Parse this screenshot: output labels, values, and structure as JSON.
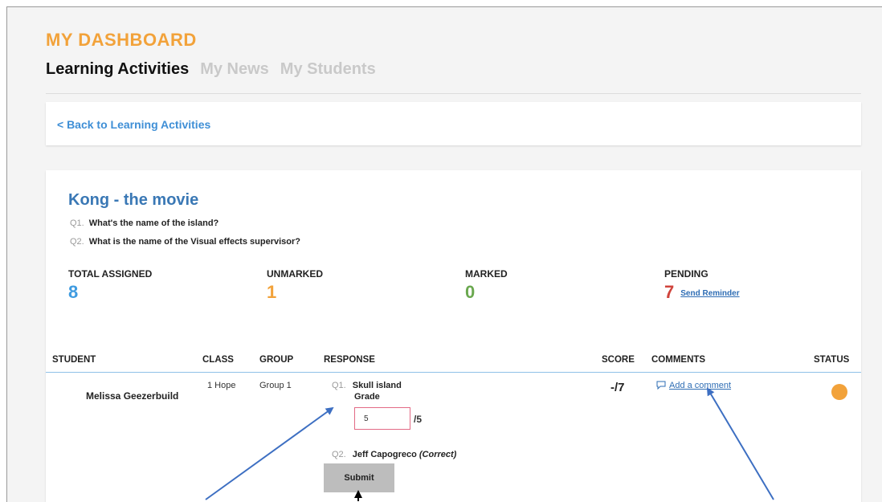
{
  "header": {
    "title": "MY DASHBOARD",
    "tabs": [
      {
        "label": "Learning Activities",
        "active": true
      },
      {
        "label": "My News",
        "active": false
      },
      {
        "label": "My Students",
        "active": false
      }
    ]
  },
  "back_link": "< Back to Learning Activities",
  "activity": {
    "title": "Kong - the movie",
    "questions": [
      {
        "num": "Q1.",
        "text": "What's the name of the island?"
      },
      {
        "num": "Q2.",
        "text": "What is the name of the Visual effects supervisor?"
      }
    ]
  },
  "stats": {
    "total_assigned": {
      "label": "TOTAL ASSIGNED",
      "value": "8",
      "color": "#3f9be0"
    },
    "unmarked": {
      "label": "UNMARKED",
      "value": "1",
      "color": "#f2a23a"
    },
    "marked": {
      "label": "MARKED",
      "value": "0",
      "color": "#6aa84f"
    },
    "pending": {
      "label": "PENDING",
      "value": "7",
      "color": "#d0443c"
    },
    "send_reminder": "Send Reminder"
  },
  "table": {
    "headers": {
      "student": "STUDENT",
      "class": "CLASS",
      "group": "GROUP",
      "response": "RESPONSE",
      "score": "SCORE",
      "comments": "COMMENTS",
      "status": "STATUS"
    },
    "row": {
      "student": "Melissa Geezerbuild",
      "class": "1 Hope",
      "group": "Group 1",
      "q1_num": "Q1.",
      "q1_answer": "Skull island",
      "grade_label": "Grade",
      "grade_value": "5",
      "grade_max": "/5",
      "q2_num": "Q2.",
      "q2_answer": "Jeff Capogreco",
      "q2_note": "(Correct)",
      "submit_label": "Submit",
      "score": "-/7",
      "comment_link": "Add a comment",
      "status_color": "#f2a23a"
    }
  },
  "annotation": {
    "arrow_color": "#3d6fc2",
    "pointer_color": "#000000"
  }
}
